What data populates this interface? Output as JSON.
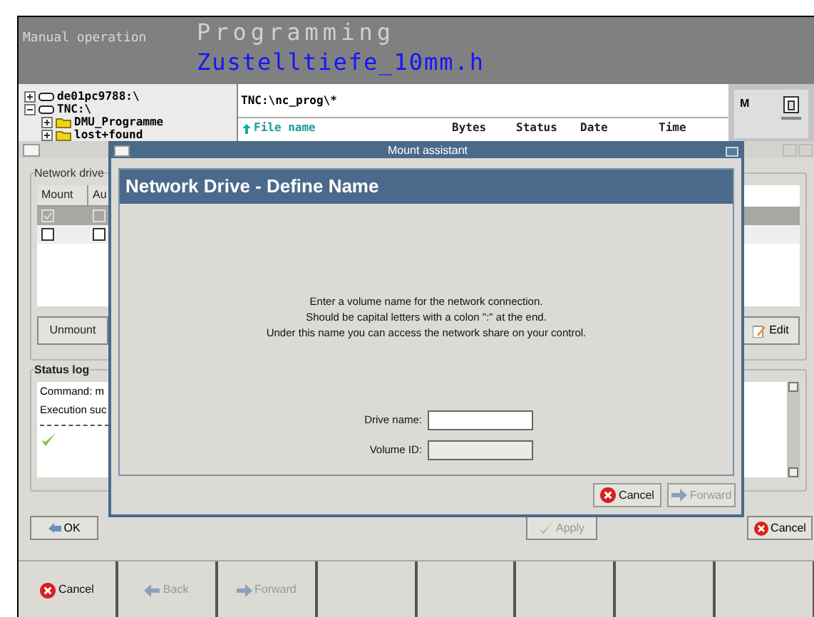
{
  "header": {
    "mode": "Manual operation",
    "title": "Programming",
    "file": "Zustelltiefe_10mm.h"
  },
  "tree": [
    {
      "label": "de01pc9788:\\",
      "kind": "drive",
      "expanded": false
    },
    {
      "label": "TNC:\\",
      "kind": "drive",
      "expanded": true,
      "children": [
        {
          "label": "DMU_Programme",
          "kind": "folder",
          "expanded": false
        },
        {
          "label": "lost+found",
          "kind": "folder",
          "expanded": false
        }
      ]
    }
  ],
  "path": "TNC:\\nc_prog\\*",
  "file_columns": [
    "File name",
    "Bytes",
    "Status",
    "Date",
    "Time"
  ],
  "side_panel": {
    "label": "M"
  },
  "back_window": {
    "group_label": "Network drive",
    "columns": [
      "Mount",
      "Au"
    ],
    "rows": [
      {
        "selected": true,
        "mount": true,
        "auto": false
      },
      {
        "selected": false,
        "mount": false,
        "auto": false
      }
    ],
    "unmount": "Unmount",
    "edit": "Edit",
    "status_label": "Status log",
    "log": [
      "Command: m",
      "Execution suc"
    ],
    "ok": "OK",
    "apply": {
      "label": "Apply",
      "disabled": true
    },
    "cancel": "Cancel"
  },
  "dialog": {
    "title": "Mount assistant",
    "heading": "Network Drive - Define Name",
    "text": [
      "Enter a volume name for the network connection.",
      "Should be capital letters with a colon \":\" at the end.",
      "Under this name you can access the network share on your control."
    ],
    "fields": [
      {
        "label": "Drive name:",
        "disabled": false
      },
      {
        "label": "Volume ID:",
        "disabled": true
      }
    ],
    "buttons": [
      {
        "kind": "cancel",
        "label": "Cancel",
        "disabled": false
      },
      {
        "kind": "forward",
        "label": "Forward",
        "disabled": true
      }
    ]
  },
  "softkeys": [
    {
      "kind": "cancel",
      "label": "Cancel",
      "disabled": false
    },
    {
      "kind": "back",
      "label": "Back",
      "disabled": true
    },
    {
      "kind": "forward",
      "label": "Forward",
      "disabled": true
    },
    {
      "kind": "blank"
    },
    {
      "kind": "blank"
    },
    {
      "kind": "blank"
    },
    {
      "kind": "blank"
    },
    {
      "kind": "blank"
    }
  ]
}
